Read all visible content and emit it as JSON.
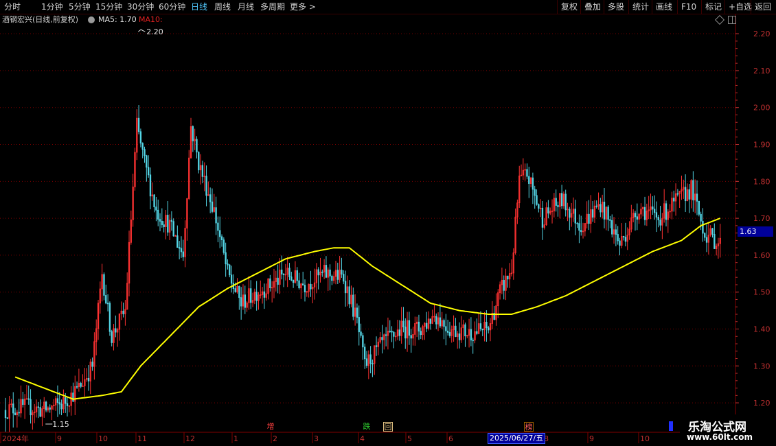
{
  "toolbar": {
    "periods": [
      "分时",
      "1分钟",
      "5分钟",
      "15分钟",
      "30分钟",
      "60分钟",
      "日线",
      "周线",
      "月线",
      "多周期",
      "更多 >"
    ],
    "active_period": "日线",
    "right_buttons": [
      "复权",
      "叠加",
      "多股",
      "统计",
      "画线",
      "F10",
      "标记",
      "+自选",
      "返回"
    ]
  },
  "info": {
    "stock_name": "酒钢宏兴(日线,前复权)",
    "ma5": "MA5: 1.70",
    "ma10": "MA10:"
  },
  "colors": {
    "up": "#ff3232",
    "down": "#54d6e6",
    "ma": "#ffff00",
    "grid": "#800000",
    "axis": "#c03030"
  },
  "current_price": "1.63",
  "markers": {
    "zeng": "增",
    "die": "跌",
    "hui": "回",
    "bang": "榜"
  },
  "date_label": "2025/06/27/五",
  "watermark": {
    "title": "乐淘公式网",
    "url": "www.60lt.com"
  },
  "chart_data": {
    "type": "candlestick",
    "ylim": [
      1.15,
      2.23
    ],
    "y_ticks": [
      1.2,
      1.3,
      1.4,
      1.5,
      1.6,
      1.7,
      1.8,
      1.9,
      2.0,
      2.1,
      2.2
    ],
    "y_tick_labels": [
      "1.20",
      "1.30",
      "1.40",
      "1.50",
      "1.60",
      "1.70",
      "1.80",
      "1.90",
      "2.00",
      "2.10",
      "2.20"
    ],
    "month_labels": [
      "2024年",
      "9",
      "10",
      "11",
      "12",
      "1",
      "2",
      "3",
      "4",
      "5",
      "6",
      "8",
      "9",
      "10"
    ],
    "annotations": {
      "high": "2.20",
      "low": "1.15"
    },
    "ma_line": [
      {
        "i": 5,
        "v": 1.27
      },
      {
        "i": 20,
        "v": 1.24
      },
      {
        "i": 35,
        "v": 1.21
      },
      {
        "i": 50,
        "v": 1.22
      },
      {
        "i": 60,
        "v": 1.23
      },
      {
        "i": 70,
        "v": 1.3
      },
      {
        "i": 85,
        "v": 1.38
      },
      {
        "i": 100,
        "v": 1.46
      },
      {
        "i": 115,
        "v": 1.51
      },
      {
        "i": 130,
        "v": 1.55
      },
      {
        "i": 145,
        "v": 1.59
      },
      {
        "i": 160,
        "v": 1.61
      },
      {
        "i": 170,
        "v": 1.62
      },
      {
        "i": 178,
        "v": 1.62
      },
      {
        "i": 190,
        "v": 1.57
      },
      {
        "i": 205,
        "v": 1.52
      },
      {
        "i": 220,
        "v": 1.47
      },
      {
        "i": 235,
        "v": 1.45
      },
      {
        "i": 250,
        "v": 1.44
      },
      {
        "i": 262,
        "v": 1.44
      },
      {
        "i": 275,
        "v": 1.46
      },
      {
        "i": 290,
        "v": 1.49
      },
      {
        "i": 305,
        "v": 1.53
      },
      {
        "i": 320,
        "v": 1.57
      },
      {
        "i": 335,
        "v": 1.61
      },
      {
        "i": 350,
        "v": 1.64
      },
      {
        "i": 360,
        "v": 1.68
      },
      {
        "i": 370,
        "v": 1.7
      }
    ],
    "price_path": [
      {
        "i": 0,
        "v": 1.18
      },
      {
        "i": 10,
        "v": 1.19
      },
      {
        "i": 20,
        "v": 1.18
      },
      {
        "i": 30,
        "v": 1.2
      },
      {
        "i": 38,
        "v": 1.24
      },
      {
        "i": 45,
        "v": 1.3
      },
      {
        "i": 50,
        "v": 1.55
      },
      {
        "i": 55,
        "v": 1.38
      },
      {
        "i": 62,
        "v": 1.45
      },
      {
        "i": 68,
        "v": 1.95
      },
      {
        "i": 72,
        "v": 1.85
      },
      {
        "i": 78,
        "v": 1.72
      },
      {
        "i": 85,
        "v": 1.68
      },
      {
        "i": 92,
        "v": 1.6
      },
      {
        "i": 96,
        "v": 1.95
      },
      {
        "i": 100,
        "v": 1.85
      },
      {
        "i": 108,
        "v": 1.72
      },
      {
        "i": 115,
        "v": 1.55
      },
      {
        "i": 122,
        "v": 1.47
      },
      {
        "i": 130,
        "v": 1.5
      },
      {
        "i": 138,
        "v": 1.52
      },
      {
        "i": 145,
        "v": 1.55
      },
      {
        "i": 155,
        "v": 1.52
      },
      {
        "i": 165,
        "v": 1.55
      },
      {
        "i": 175,
        "v": 1.54
      },
      {
        "i": 182,
        "v": 1.42
      },
      {
        "i": 186,
        "v": 1.3
      },
      {
        "i": 195,
        "v": 1.36
      },
      {
        "i": 205,
        "v": 1.4
      },
      {
        "i": 215,
        "v": 1.4
      },
      {
        "i": 222,
        "v": 1.44
      },
      {
        "i": 230,
        "v": 1.4
      },
      {
        "i": 240,
        "v": 1.39
      },
      {
        "i": 250,
        "v": 1.4
      },
      {
        "i": 256,
        "v": 1.5
      },
      {
        "i": 262,
        "v": 1.56
      },
      {
        "i": 266,
        "v": 1.8
      },
      {
        "i": 270,
        "v": 1.82
      },
      {
        "i": 278,
        "v": 1.7
      },
      {
        "i": 288,
        "v": 1.75
      },
      {
        "i": 298,
        "v": 1.68
      },
      {
        "i": 308,
        "v": 1.74
      },
      {
        "i": 318,
        "v": 1.63
      },
      {
        "i": 328,
        "v": 1.73
      },
      {
        "i": 338,
        "v": 1.7
      },
      {
        "i": 348,
        "v": 1.75
      },
      {
        "i": 355,
        "v": 1.78
      },
      {
        "i": 362,
        "v": 1.66
      },
      {
        "i": 370,
        "v": 1.63
      }
    ]
  }
}
